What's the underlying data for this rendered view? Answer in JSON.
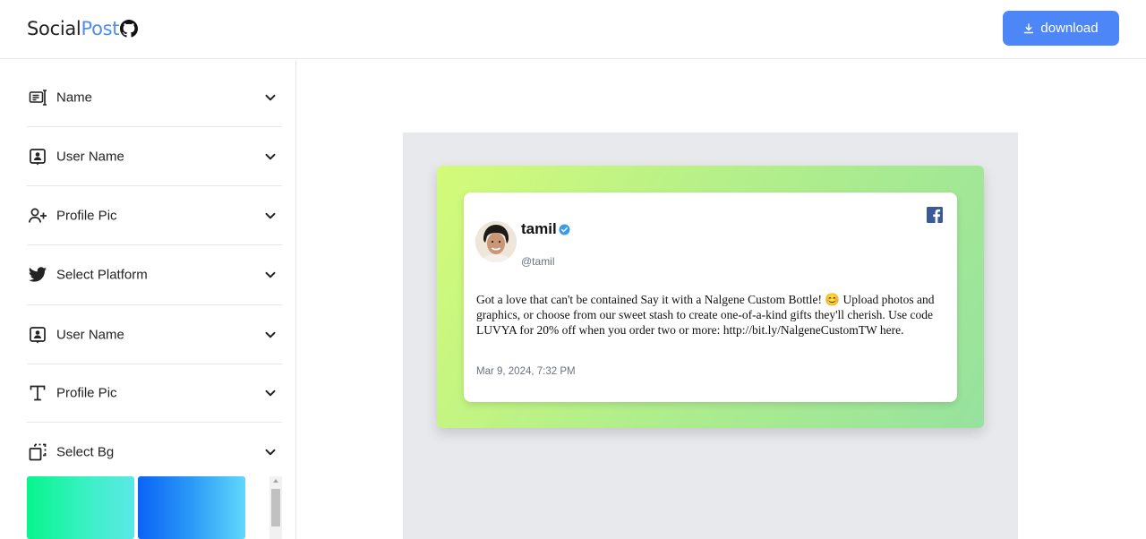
{
  "header": {
    "logo_part1": "Social",
    "logo_part2": "Post",
    "download_label": "download"
  },
  "sidebar": {
    "items": [
      {
        "label": "Name",
        "icon": "name-card-icon"
      },
      {
        "label": "User Name",
        "icon": "user-badge-icon"
      },
      {
        "label": "Profile Pic",
        "icon": "user-plus-icon"
      },
      {
        "label": "Select Platform",
        "icon": "twitter-icon"
      },
      {
        "label": "User Name",
        "icon": "user-badge-icon"
      },
      {
        "label": "Profile Pic",
        "icon": "text-t-icon"
      },
      {
        "label": "Select Bg",
        "icon": "select-bg-icon"
      }
    ],
    "bg_options": [
      {
        "name": "green-teal",
        "colors": [
          "#06f58d",
          "#5ae8e6"
        ]
      },
      {
        "name": "blue-cyan",
        "colors": [
          "#0a63f5",
          "#5fd8fb"
        ]
      }
    ]
  },
  "post": {
    "display_name": "tamil",
    "handle": "@tamil",
    "platform": "facebook",
    "text": "Got a love that can't be contained Say it with a Nalgene Custom Bottle! 😊 Upload photos and graphics, or choose from our sweet stash to create one-of-a-kind gifts they'll cherish. Use code LUVYA for 20% off when you order two or more: http://bit.ly/NalgeneCustomTW here.",
    "timestamp": "Mar 9, 2024, 7:32 PM",
    "background_gradient": [
      "#d4fb79",
      "#96e29e"
    ]
  },
  "colors": {
    "accent": "#4d86f6",
    "verified": "#3b9be8",
    "facebook": "#3b5998"
  }
}
